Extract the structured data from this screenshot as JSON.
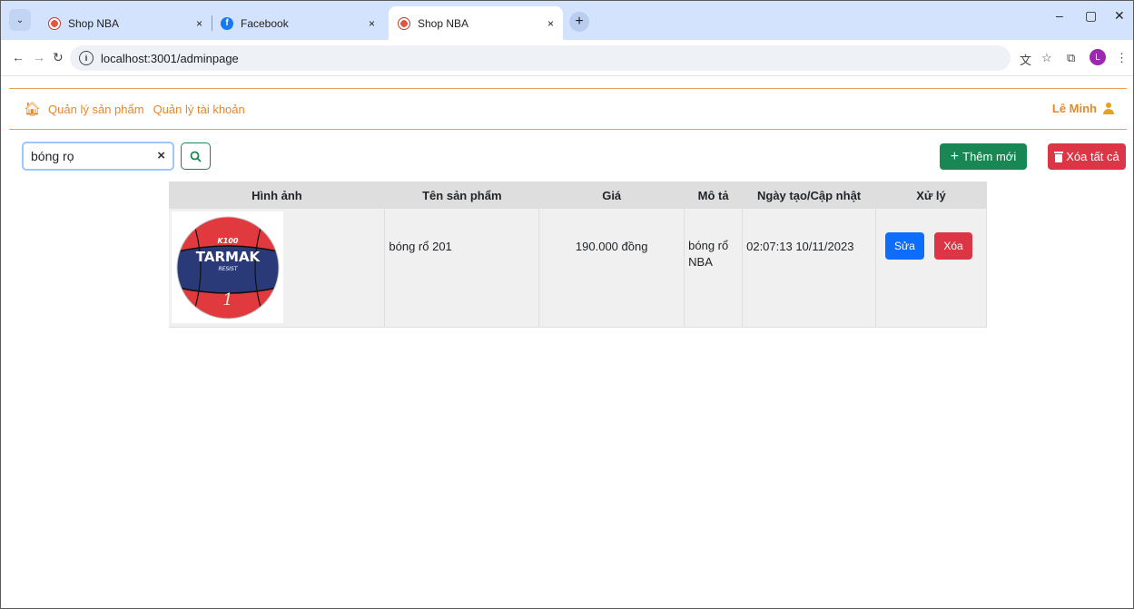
{
  "browser": {
    "tabs": [
      {
        "title": "Shop NBA",
        "close": "×"
      },
      {
        "title": "Facebook",
        "close": "×"
      },
      {
        "title": "Shop NBA",
        "close": "×"
      }
    ],
    "url": "localhost:3001/adminpage",
    "profile_initial": "L"
  },
  "header": {
    "nav_products": "Quản lý sản phẩm",
    "nav_accounts": "Quản lý tài khoản",
    "user_name": "Lê Minh"
  },
  "search": {
    "value": "bóng rọ",
    "clear": "×"
  },
  "actions": {
    "add_label": "Thêm mới",
    "delete_all_label": "Xóa tất cả"
  },
  "table": {
    "headers": [
      "Hình ảnh",
      "Tên sản phẩm",
      "Giá",
      "Mô tả",
      "Ngày tạo/Cập nhật",
      "Xử lý"
    ],
    "rows": [
      {
        "image_text_top": "K100",
        "image_text_brand": "TARMAK",
        "image_text_sub": "RESIST",
        "name": "bóng rổ 201",
        "price": "190.000 đồng",
        "description": "bóng rổ NBA",
        "date": "02:07:13 10/11/2023",
        "edit_label": "Sửa",
        "delete_label": "Xóa"
      }
    ]
  },
  "colors": {
    "accent": "#e8862a",
    "add": "#198754",
    "delete": "#dc3545",
    "edit": "#0d6efd"
  }
}
